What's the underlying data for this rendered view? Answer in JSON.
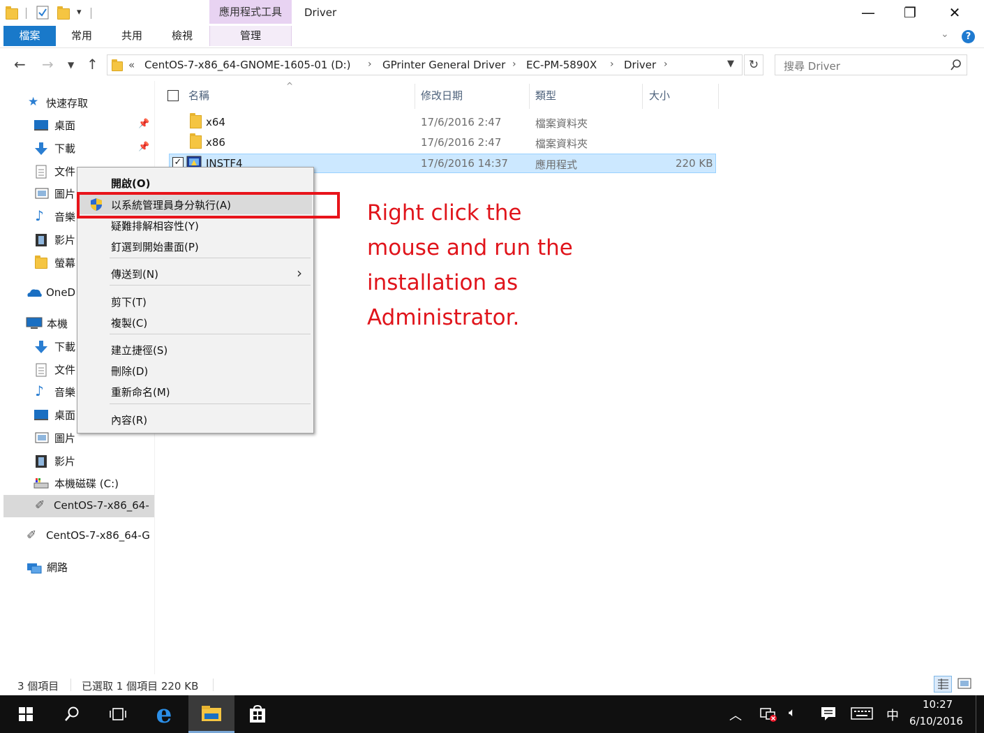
{
  "window": {
    "title": "Driver",
    "contextual_tab_group": "應用程式工具",
    "controls": {
      "minimize": "—",
      "restore": "❐",
      "close": "✕"
    }
  },
  "ribbon": {
    "tabs": [
      "檔案",
      "常用",
      "共用",
      "檢視",
      "管理"
    ]
  },
  "address": {
    "overflow": "«",
    "crumbs": [
      "CentOS-7-x86_64-GNOME-1605-01 (D:)",
      "GPrinter General Driver",
      "EC-PM-5890X",
      "Driver"
    ],
    "search_placeholder": "搜尋 Driver"
  },
  "nav_pane": {
    "items": [
      {
        "label": "快速存取",
        "icon": "star-icon"
      },
      {
        "label": "桌面",
        "icon": "desktop-icon",
        "pinned": true
      },
      {
        "label": "下載",
        "icon": "download-icon",
        "pinned": true
      },
      {
        "label": "文件",
        "icon": "document-icon"
      },
      {
        "label": "圖片",
        "icon": "pictures-icon"
      },
      {
        "label": "音樂",
        "icon": "music-icon"
      },
      {
        "label": "影片",
        "icon": "video-icon"
      },
      {
        "label": "螢幕",
        "icon": "folder-icon"
      },
      {
        "label": "OneD",
        "icon": "onedrive-icon"
      },
      {
        "label": "本機",
        "icon": "this-pc-icon"
      },
      {
        "label": "下載",
        "icon": "download-icon"
      },
      {
        "label": "文件",
        "icon": "document-icon"
      },
      {
        "label": "音樂",
        "icon": "music-icon"
      },
      {
        "label": "桌面",
        "icon": "desktop-icon"
      },
      {
        "label": "圖片",
        "icon": "pictures-icon"
      },
      {
        "label": "影片",
        "icon": "video-icon"
      },
      {
        "label": "本機磁碟 (C:)",
        "icon": "drive-icon"
      },
      {
        "label": "CentOS-7-x86_64-",
        "icon": "usb-drive-icon"
      },
      {
        "label": "CentOS-7-x86_64-G",
        "icon": "usb-drive-icon"
      },
      {
        "label": "網路",
        "icon": "network-icon"
      }
    ]
  },
  "file_list": {
    "columns": [
      "名稱",
      "修改日期",
      "類型",
      "大小"
    ],
    "rows": [
      {
        "name": "x64",
        "date": "17/6/2016 2:47",
        "type": "檔案資料夾",
        "size": ""
      },
      {
        "name": "x86",
        "date": "17/6/2016 2:47",
        "type": "檔案資料夾",
        "size": ""
      },
      {
        "name": "INSTF4",
        "date": "17/6/2016 14:37",
        "type": "應用程式",
        "size": "220 KB"
      }
    ]
  },
  "context_menu": {
    "items": [
      "開啟(O)",
      "以系統管理員身分執行(A)",
      "疑難排解相容性(Y)",
      "釘選到開始畫面(P)",
      "傳送到(N)",
      "剪下(T)",
      "複製(C)",
      "建立捷徑(S)",
      "刪除(D)",
      "重新命名(M)",
      "內容(R)"
    ]
  },
  "annotation": {
    "lines": [
      "Right click the",
      "mouse and run the",
      "installation as",
      "Administrator."
    ],
    "color": "#e0141b"
  },
  "status": {
    "item_count": "3 個項目",
    "selection": "已選取 1 個項目  220 KB"
  },
  "taskbar": {
    "time": "10:27",
    "date": "6/10/2016",
    "ime": "中"
  }
}
